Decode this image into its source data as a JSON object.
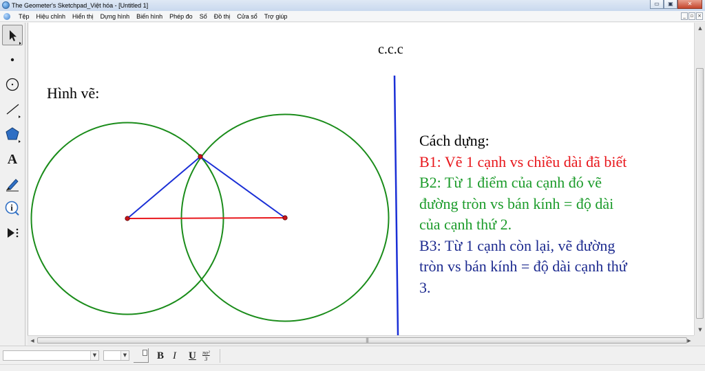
{
  "window": {
    "title": "The Geometer's Sketchpad_Việt hóa - [Untitled 1]",
    "buttons": {
      "minimize": "▭",
      "maximize": "▣",
      "close": "✕"
    }
  },
  "menu": {
    "items": [
      "Tệp",
      "Hiệu chỉnh",
      "Hiển thị",
      "Dựng hình",
      "Biến hình",
      "Phép đo",
      "Số",
      "Đồ thị",
      "Cửa sổ",
      "Trợ giúp"
    ],
    "mdi_buttons": {
      "minimize": "_",
      "restore": "▫",
      "close": "×"
    }
  },
  "toolbox": {
    "tools": [
      {
        "id": "arrow",
        "icon": "arrow-select-icon",
        "selected": true
      },
      {
        "id": "point",
        "icon": "point-icon"
      },
      {
        "id": "compass",
        "icon": "compass-circle-icon"
      },
      {
        "id": "straightedge",
        "icon": "straightedge-icon"
      },
      {
        "id": "polygon",
        "icon": "polygon-icon"
      },
      {
        "id": "text",
        "icon": "text-tool-icon",
        "glyph": "A"
      },
      {
        "id": "marker",
        "icon": "marker-pen-icon"
      },
      {
        "id": "information",
        "icon": "information-icon",
        "glyph": "i"
      },
      {
        "id": "custom",
        "icon": "custom-tool-icon"
      }
    ]
  },
  "sketch": {
    "heading": "c.c.c",
    "figure_label": "Hình vẽ:",
    "instructions": [
      {
        "text": "Cách dựng:",
        "color": "#000000"
      },
      {
        "text": "B1: Vẽ 1 cạnh vs chiều dài đã biết",
        "color": "#e8161b"
      },
      {
        "text": "B2: Từ 1 điểm của cạnh đó vẽ",
        "color": "#1b9b2a"
      },
      {
        "text": "đường tròn vs bán kính = độ dài",
        "color": "#1b9b2a"
      },
      {
        "text": "của cạnh thứ 2.",
        "color": "#1b9b2a"
      },
      {
        "text": "B3: Từ 1 cạnh còn lại, vẽ đường",
        "color": "#1c2a8f"
      },
      {
        "text": "tròn vs bán kính = độ dài cạnh thứ",
        "color": "#1c2a8f"
      },
      {
        "text": "3.",
        "color": "#1c2a8f"
      }
    ],
    "colors": {
      "circle": "#1a8c1a",
      "base_segment": "#e8161b",
      "triangle_sides": "#1a2fd6",
      "divider": "#1a2fd6",
      "points": "#c8141b"
    }
  },
  "format_bar": {
    "bold_label": "B",
    "italic_label": "I",
    "underline_label": "U",
    "math_label_top": "πα²",
    "math_label_bottom": "3"
  }
}
